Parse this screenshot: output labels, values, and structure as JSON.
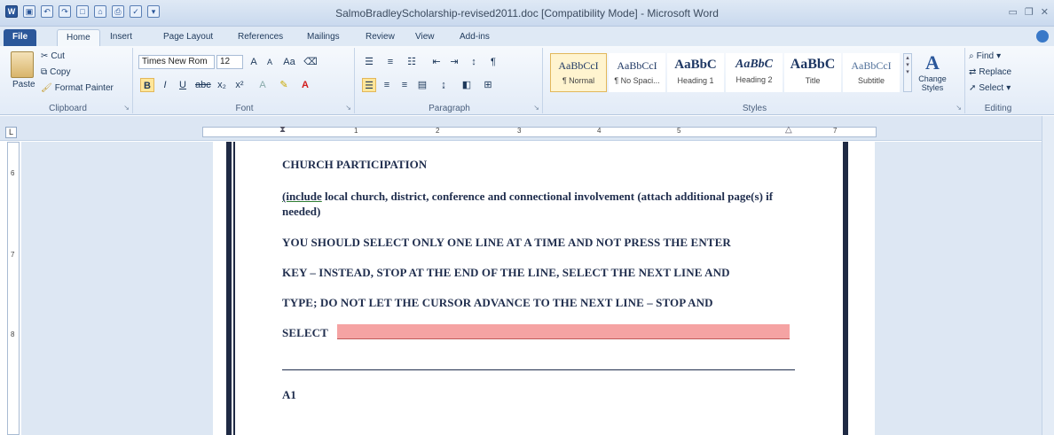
{
  "window": {
    "title": "SalmoBradleyScholarship-revised2011.doc [Compatibility Mode] - Microsoft Word"
  },
  "tabs": [
    "File",
    "Home",
    "Insert",
    "Page Layout",
    "References",
    "Mailings",
    "Review",
    "View",
    "Add-ins"
  ],
  "clipboard": {
    "paste": "Paste",
    "cut": "Cut",
    "copy": "Copy",
    "format_painter": "Format Painter",
    "label": "Clipboard"
  },
  "font": {
    "family": "Times New Rom",
    "size": "12",
    "label": "Font"
  },
  "paragraph": {
    "label": "Paragraph"
  },
  "styles": {
    "items": [
      {
        "sample": "AaBbCcI",
        "name": "¶ Normal"
      },
      {
        "sample": "AaBbCcI",
        "name": "¶ No Spaci..."
      },
      {
        "sample": "AaBbC",
        "name": "Heading 1"
      },
      {
        "sample": "AaBbC",
        "name": "Heading 2"
      },
      {
        "sample": "AaBbC",
        "name": "Title"
      },
      {
        "sample": "AaBbCcI",
        "name": "Subtitle"
      }
    ],
    "change_styles": "Change Styles",
    "label": "Styles"
  },
  "editing": {
    "find": "Find",
    "replace": "Replace",
    "select": "Select",
    "label": "Editing"
  },
  "ruler": {
    "numbers": [
      "1",
      "2",
      "3",
      "4",
      "5",
      "7"
    ]
  },
  "vruler": {
    "numbers": [
      "6",
      "7",
      "8"
    ]
  },
  "document": {
    "heading": "CHURCH PARTICIPATION",
    "instruction_link": "(include",
    "instruction_rest": " local church, district, conference and connectional involvement (attach additional page(s) if needed)",
    "line1": "YOU SHOULD SELECT ONLY ONE LINE AT A TIME AND NOT PRESS THE ENTER",
    "line2": "KEY – INSTEAD, STOP AT THE END OF THE LINE, SELECT THE NEXT LINE AND",
    "line3": "TYPE; DO NOT LET THE CURSOR ADVANCE TO THE NEXT LINE – STOP AND",
    "line4": "SELECT",
    "section": "A1"
  },
  "colors": {
    "word_blue": "#2b579a",
    "selection_pink": "#f5a3a3",
    "page_border": "#1f2a44"
  }
}
